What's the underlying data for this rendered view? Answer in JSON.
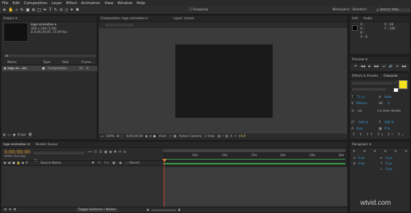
{
  "menu": [
    "File",
    "Edit",
    "Composition",
    "Layer",
    "Effect",
    "Animation",
    "View",
    "Window",
    "Help"
  ],
  "toolbar": {
    "snapping": "Snapping",
    "workspace_label": "Workspace:",
    "workspace_value": "Standard",
    "search_placeholder": "Search Help"
  },
  "project": {
    "tab": "Project ≡",
    "comp_name": "logo animation ▾",
    "comp_size": "320 x 240 (1.00)",
    "comp_duration": "Δ 0;00;30;00, 15.00 fps",
    "columns": {
      "name": "Name",
      "type": "Type",
      "size": "Size",
      "frame_rate": "Frame ..."
    },
    "row": {
      "name": "logo an...ion",
      "type": "Composition",
      "frame_rate": "15"
    },
    "bpc": "8 bpc"
  },
  "comp_panel": {
    "tab1": "Composition: logo animation ▾",
    "tab2": "Layer: (none)",
    "subtab": "logo animation",
    "zoom": "100%",
    "timecode": "0;00;00;00",
    "resolution": "(Full)",
    "camera": "Active Camera",
    "view": "1 View",
    "offset": "+0.0"
  },
  "info": {
    "tab1": "Info",
    "tab2": "Audio",
    "r": "R :",
    "g": "G :",
    "b": "B :",
    "a": "A : 0",
    "x": "X : 28",
    "y": "Y : 146"
  },
  "preview": {
    "tab": "Preview ≡"
  },
  "character": {
    "tab1": "Effects & Presets",
    "tab2": "Characte",
    "font": "Times New Roman",
    "style": "Regular",
    "size": "72 px",
    "leading": "Auto",
    "kerning": "Metrics",
    "tracking": "0",
    "stroke_w": "- px",
    "stroke_type": "Fill Over Stroke",
    "vscale": "100 %",
    "hscale": "100 %",
    "baseline": "0 px",
    "tsume": "0 %",
    "color_fill": "#f5e21b"
  },
  "paragraph": {
    "tab": "Paragraph ≡"
  },
  "timeline": {
    "tab1": "logo animation ≡",
    "tab2": "Render Queue",
    "timecode": "0;00;00;00",
    "timecode_sub": "00000 (15.00 fps)",
    "search_placeholder": "P▾",
    "source_col": "Source Name",
    "parent_col": "Parent",
    "ruler": [
      "00s",
      "05s",
      "10s",
      "15s",
      "20s",
      "25s",
      "30s"
    ],
    "toggle": "Toggle Switches / Modes"
  },
  "watermark": "wtvid.com"
}
